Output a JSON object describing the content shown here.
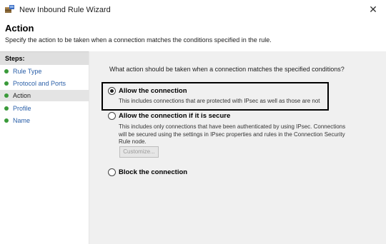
{
  "window": {
    "title": "New Inbound Rule Wizard",
    "close_glyph": "✕"
  },
  "header": {
    "title": "Action",
    "description": "Specify the action to be taken when a connection matches the conditions specified in the rule."
  },
  "steps": {
    "header": "Steps:",
    "items": [
      {
        "label": "Rule Type",
        "active": false
      },
      {
        "label": "Protocol and Ports",
        "active": false
      },
      {
        "label": "Action",
        "active": true
      },
      {
        "label": "Profile",
        "active": false
      },
      {
        "label": "Name",
        "active": false
      }
    ]
  },
  "main": {
    "question": "What action should be taken when a connection matches the specified conditions?",
    "options": [
      {
        "label": "Allow the connection",
        "description": "This includes connections that are protected with IPsec as well as those are not",
        "selected": true
      },
      {
        "label": "Allow the connection if it is secure",
        "description": "This includes only connections that have been authenticated by using IPsec. Connections will be secured using the settings in IPsec properties and rules in the Connection Security Rule node.",
        "selected": false,
        "button_label": "Customize..."
      },
      {
        "label": "Block the connection",
        "selected": false
      }
    ]
  },
  "colors": {
    "step_bullet": "#3a9a3a",
    "step_link": "#2a5fa8",
    "content_bg": "#f0f0f0"
  },
  "icons": {
    "app": "firewall-rule-icon",
    "close": "close-icon",
    "bullet": "green-bullet-icon"
  }
}
